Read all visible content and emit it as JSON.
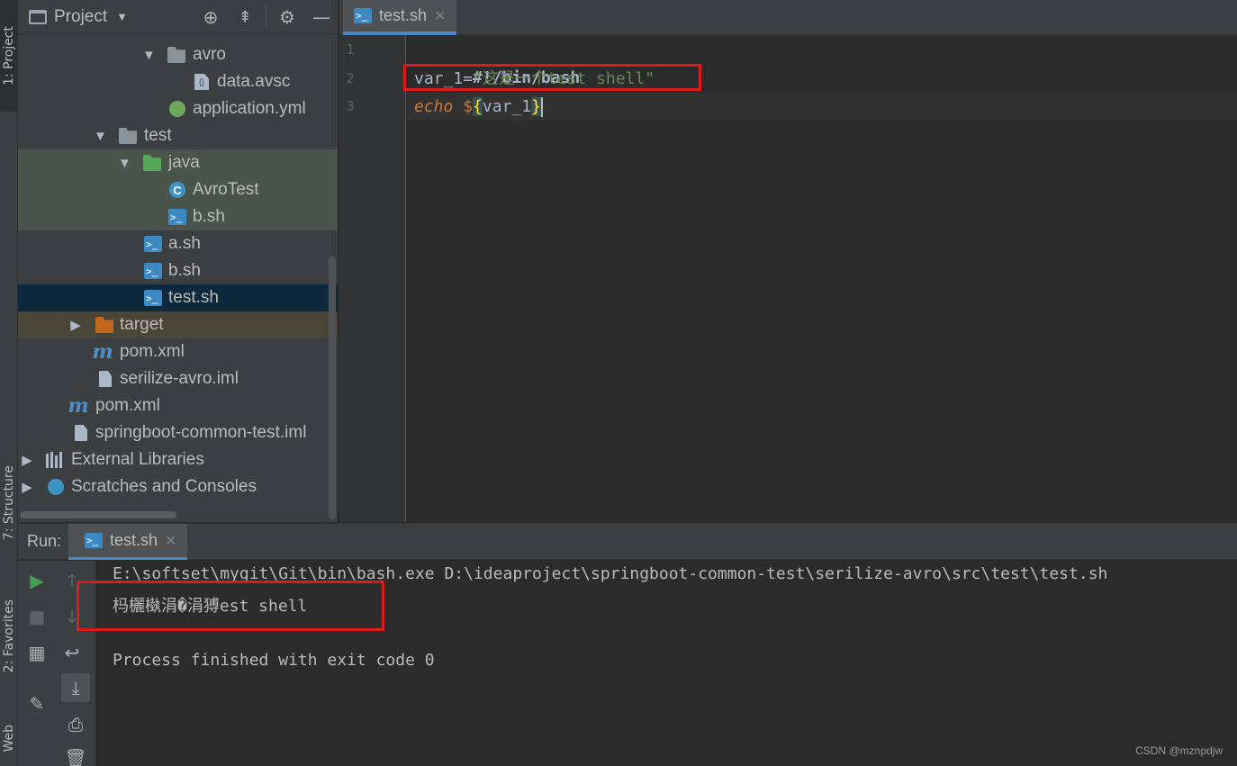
{
  "left_strip": {
    "project_tab": "1: Project",
    "structure_tab": "7: Structure",
    "favorites_tab": "2: Favorites",
    "web_tab": "Web"
  },
  "project_panel": {
    "title": "Project",
    "tree": [
      {
        "label": "avro",
        "icon": "folder-icon"
      },
      {
        "label": "data.avsc",
        "icon": "avro-schema-file-icon"
      },
      {
        "label": "application.yml",
        "icon": "spring-yml-file-icon"
      },
      {
        "label": "test",
        "icon": "folder-icon"
      },
      {
        "label": "java",
        "icon": "test-source-folder-icon"
      },
      {
        "label": "AvroTest",
        "icon": "java-class-icon"
      },
      {
        "label": "b.sh",
        "icon": "shell-script-icon"
      },
      {
        "label": "a.sh",
        "icon": "shell-script-icon"
      },
      {
        "label": "b.sh",
        "icon": "shell-script-icon"
      },
      {
        "label": "test.sh",
        "icon": "shell-script-icon"
      },
      {
        "label": "target",
        "icon": "excluded-folder-icon"
      },
      {
        "label": "pom.xml",
        "icon": "maven-icon"
      },
      {
        "label": "serilize-avro.iml",
        "icon": "module-file-icon"
      },
      {
        "label": "pom.xml",
        "icon": "maven-icon"
      },
      {
        "label": "springboot-common-test.iml",
        "icon": "module-file-icon"
      },
      {
        "label": "External Libraries",
        "icon": "libraries-icon"
      },
      {
        "label": "Scratches and Consoles",
        "icon": "scratches-icon"
      }
    ]
  },
  "editor": {
    "tab_label": "test.sh",
    "line_numbers": [
      "1",
      "2",
      "3"
    ],
    "code": {
      "line1": "#!/bin/bash",
      "line2_var": "var_1=",
      "line2_str": "\"这是一个test shell\"",
      "line3_kw": "echo",
      "line3_dollar": "$",
      "line3_open": "{",
      "line3_var": "var_1",
      "line3_close": "}"
    }
  },
  "run_panel": {
    "label": "Run:",
    "tab_label": "test.sh",
    "console": [
      "E:\\softset\\mygit\\Git\\bin\\bash.exe D:\\ideaproject\\springboot-common-test\\serilize-avro\\src\\test\\test.sh",
      "杩欐槸涓�涓猼est shell",
      "",
      "Process finished with exit code 0"
    ]
  },
  "watermark": "CSDN @mznpdjw",
  "colors": {
    "accent": "#4a88c7",
    "highlight_box": "#e0191a",
    "string": "#6a8759",
    "keyword": "#cc7832"
  }
}
